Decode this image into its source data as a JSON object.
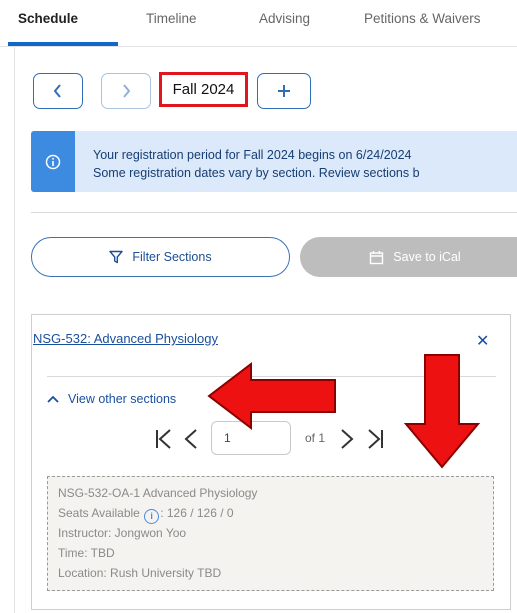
{
  "tabs": [
    {
      "label": "Schedule"
    },
    {
      "label": "Timeline"
    },
    {
      "label": "Advising"
    },
    {
      "label": "Petitions & Waivers"
    }
  ],
  "term": {
    "label": "Fall 2024"
  },
  "banner": {
    "line1": "Your registration period for Fall 2024 begins on 6/24/2024",
    "line2": "Some registration dates vary by section. Review sections b"
  },
  "actions": {
    "filter_label": "Filter Sections",
    "ical_label": "Save to iCal"
  },
  "course": {
    "title": "NSG-532: Advanced Physiology",
    "close": "✕",
    "view_other_label": "View other sections",
    "pager": {
      "current": "1",
      "of_label": "of 1"
    },
    "section": {
      "name": "NSG-532-OA-1 Advanced Physiology",
      "seats_label": "Seats Available",
      "seats_value": ": 126 / 126 / 0",
      "instructor": "Instructor: Jongwon Yoo",
      "time": "Time: TBD",
      "location": "Location: Rush University TBD"
    }
  },
  "colors": {
    "accent": "#1168c7",
    "highlight": "#e0161e",
    "banner_bg": "#dbe9fa",
    "banner_icon": "#3c8be0"
  }
}
